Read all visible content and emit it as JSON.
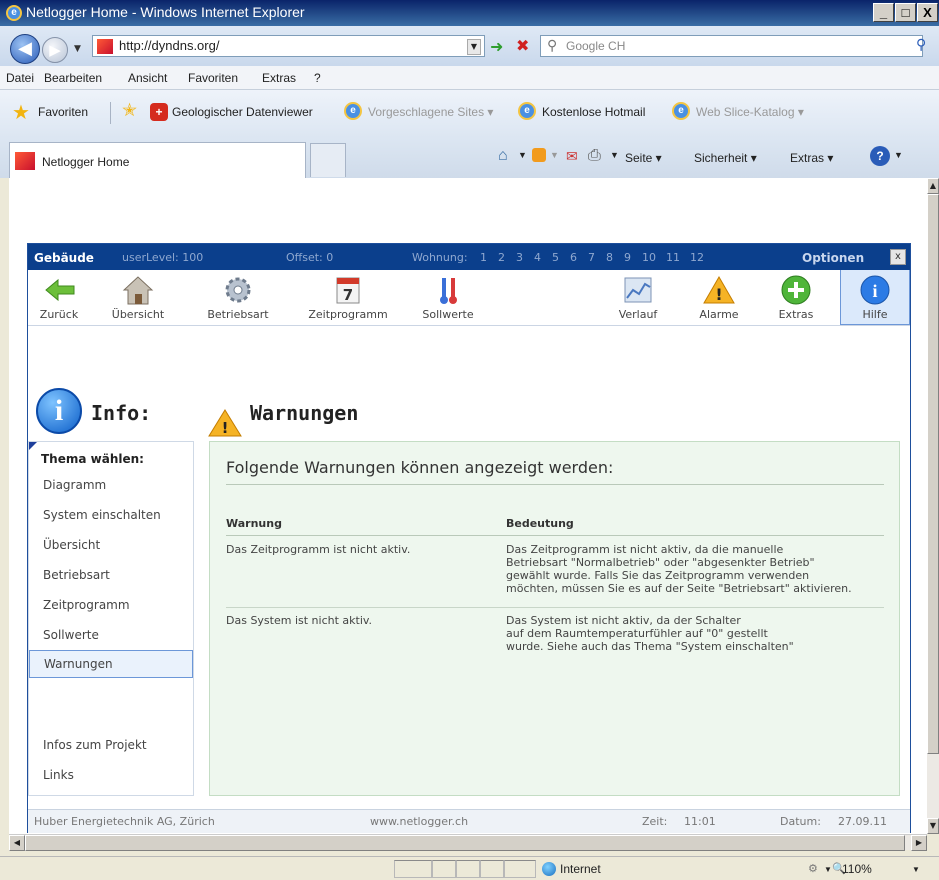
{
  "window": {
    "title": "Netlogger Home - Windows Internet Explorer",
    "min": "_",
    "max": "□",
    "close": "X"
  },
  "address": {
    "url": "http://dyndns.org/",
    "search_placeholder": "Google CH"
  },
  "menu": [
    "Datei",
    "Bearbeiten",
    "Ansicht",
    "Favoriten",
    "Extras",
    "?"
  ],
  "favbar": {
    "favorites": "Favoriten",
    "items": [
      "Geologischer Datenviewer",
      "Vorgeschlagene Sites ▾",
      "Kostenlose Hotmail",
      "Web Slice-Katalog ▾"
    ]
  },
  "tab": {
    "label": "Netlogger Home"
  },
  "commandbar": [
    "Seite ▾",
    "Sicherheit ▾",
    "Extras ▾"
  ],
  "app": {
    "header": {
      "title": "Gebäude",
      "userlevel": "userLevel: 100",
      "offset": "Offset: 0",
      "wohnung_label": "Wohnung:",
      "wohnungen": [
        "1",
        "2",
        "3",
        "4",
        "5",
        "6",
        "7",
        "8",
        "9",
        "10",
        "11",
        "12"
      ],
      "optionen": "Optionen",
      "close": "x"
    },
    "toolbar": [
      {
        "label": "Zurück",
        "icon": "back-arrow-icon"
      },
      {
        "label": "Übersicht",
        "icon": "house-icon"
      },
      {
        "label": "Betriebsart",
        "icon": "gear-icon"
      },
      {
        "label": "Zeitprogramm",
        "icon": "calendar-icon"
      },
      {
        "label": "Sollwerte",
        "icon": "thermometer-icon"
      },
      {
        "label": "Verlauf",
        "icon": "chart-icon"
      },
      {
        "label": "Alarme",
        "icon": "warning-icon"
      },
      {
        "label": "Extras",
        "icon": "plus-icon"
      },
      {
        "label": "Hilfe",
        "icon": "info-icon"
      }
    ],
    "info_title": "Info:",
    "section_title": "Warnungen",
    "sidenav": {
      "header": "Thema wählen:",
      "items": [
        "Diagramm",
        "System einschalten",
        "Übersicht",
        "Betriebsart",
        "Zeitprogramm",
        "Sollwerte",
        "Warnungen"
      ],
      "bottom_items": [
        "Infos zum Projekt",
        "Links"
      ],
      "selected": "Warnungen"
    },
    "panel": {
      "heading": "Folgende Warnungen können angezeigt werden:",
      "col_warnung": "Warnung",
      "col_bedeutung": "Bedeutung",
      "rows": [
        {
          "warnung": "Das Zeitprogramm ist nicht aktiv.",
          "bedeutung": "Das Zeitprogramm ist nicht aktiv, da die manuelle\nBetriebsart \"Normalbetrieb\" oder \"abgesenkter Betrieb\"\ngewählt wurde. Falls Sie das Zeitprogramm verwenden\nmöchten, müssen Sie es auf der Seite \"Betriebsart\" aktivieren."
        },
        {
          "warnung": "Das System ist nicht aktiv.",
          "bedeutung": "Das System ist nicht aktiv, da der Schalter\nauf dem Raumtemperaturfühler auf \"0\" gestellt\nwurde. Siehe auch das Thema \"System einschalten\""
        }
      ]
    },
    "footer": {
      "company": "Huber Energietechnik AG, Zürich",
      "website": "www.netlogger.ch",
      "zeit_label": "Zeit:",
      "zeit": "11:01",
      "datum_label": "Datum:",
      "datum": "27.09.11"
    }
  },
  "statusbar": {
    "zone": "Internet",
    "zoom": "110%"
  }
}
